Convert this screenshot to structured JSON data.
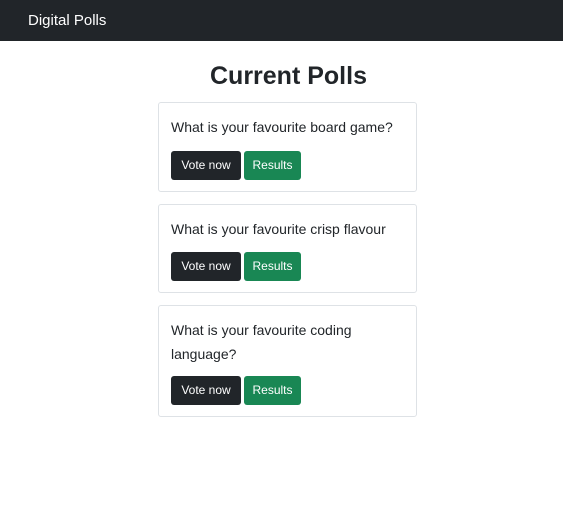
{
  "navbar": {
    "brand": "Digital Polls"
  },
  "main": {
    "title": "Current Polls",
    "polls": [
      {
        "question": "What is your favourite board game?",
        "vote_label": "Vote now",
        "results_label": "Results"
      },
      {
        "question": "What is your favourite crisp flavour",
        "vote_label": "Vote now",
        "results_label": "Results"
      },
      {
        "question": "What is your favourite coding language?",
        "vote_label": "Vote now",
        "results_label": "Results"
      }
    ]
  },
  "colors": {
    "navbar_bg": "#212529",
    "vote_button": "#212529",
    "results_button": "#198754",
    "card_border": "#dee2e6"
  }
}
